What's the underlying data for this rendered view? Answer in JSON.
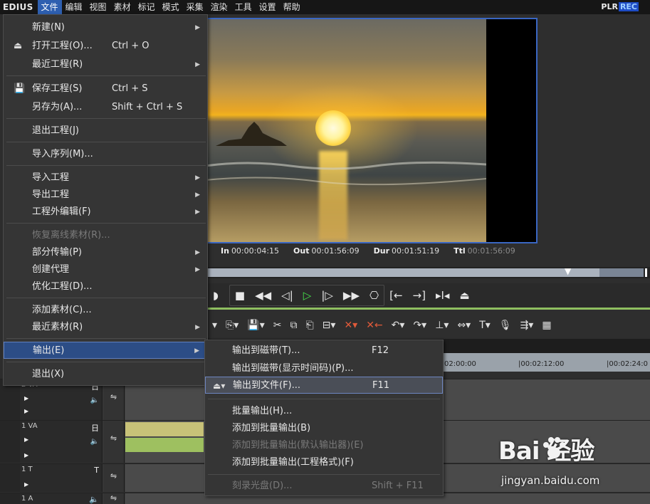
{
  "menubar": {
    "logo": "EDIUS",
    "items": [
      "文件",
      "编辑",
      "视图",
      "素材",
      "标记",
      "模式",
      "采集",
      "渲染",
      "工具",
      "设置",
      "帮助"
    ],
    "plr": "PLR",
    "rec": "REC"
  },
  "timecodes": {
    "in_label": "In",
    "in_value": "00:00:04:15",
    "out_label": "Out",
    "out_value": "00:01:56:09",
    "dur_label": "Dur",
    "dur_value": "00:01:51:19",
    "ttl_label": "Ttl",
    "ttl_value": "00:01:56:09"
  },
  "ruler": {
    "ticks": [
      "02:00:00",
      "|00:02:12:00",
      "|00:02:24:0"
    ]
  },
  "tracks": [
    {
      "name": "2 VA"
    },
    {
      "name": "1 VA"
    },
    {
      "name": "1 T"
    },
    {
      "name": "1 A"
    }
  ],
  "file_menu": {
    "new": "新建(N)",
    "open": "打开工程(O)...",
    "open_sc": "Ctrl + O",
    "recent_project": "最近工程(R)",
    "save": "保存工程(S)",
    "save_sc": "Ctrl + S",
    "save_as": "另存为(A)...",
    "save_as_sc": "Shift + Ctrl + S",
    "exit_project": "退出工程(J)",
    "import_sequence": "导入序列(M)...",
    "import_project": "导入工程",
    "export_project": "导出工程",
    "external_edit": "工程外编辑(F)",
    "restore_offline": "恢复离线素材(R)...",
    "partial_transfer": "部分传输(P)",
    "create_proxy": "创建代理",
    "optimize_project": "优化工程(D)...",
    "add_clip": "添加素材(C)...",
    "recent_clip": "最近素材(R)",
    "output": "输出(E)",
    "exit": "退出(X)"
  },
  "output_submenu": {
    "to_tape": "输出到磁带(T)...",
    "to_tape_sc": "F12",
    "to_tape_tc": "输出到磁带(显示时间码)(P)...",
    "to_file": "输出到文件(F)...",
    "to_file_sc": "F11",
    "batch": "批量输出(H)...",
    "add_batch": "添加到批量输出(B)",
    "add_batch_default": "添加到批量输出(默认输出器)(E)",
    "add_batch_project": "添加到批量输出(工程格式)(F)",
    "burn_disc": "刻录光盘(D)...",
    "burn_disc_sc": "Shift + F11"
  },
  "watermark": {
    "logo": "Bai  经验",
    "url": "jingyan.baidu.com"
  }
}
